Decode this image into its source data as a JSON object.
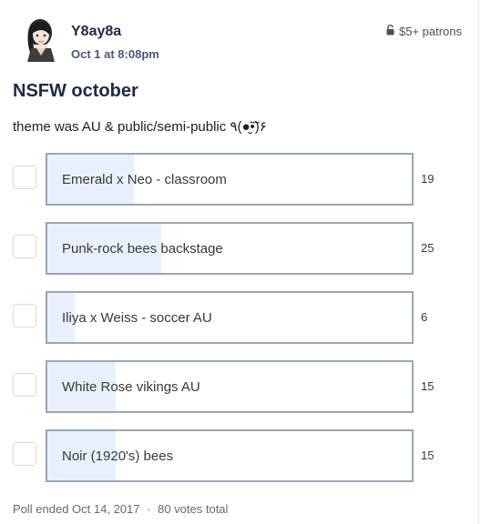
{
  "post": {
    "author": "Y8ay8a",
    "date": "Oct 1 at 8:08pm",
    "tier_label": "$5+ patrons",
    "tier_icon": "lock-icon",
    "title": "NSFW october",
    "description": "theme was AU & public/semi-public ٩(●̮̮̃•̃)۶"
  },
  "poll": {
    "total_votes": 80,
    "options": [
      {
        "label": "Emerald x Neo - classroom",
        "votes": "19",
        "fraction": 0.2375
      },
      {
        "label": "Punk-rock bees backstage",
        "votes": "25",
        "fraction": 0.3125
      },
      {
        "label": "Iliya x Weiss - soccer AU",
        "votes": "6",
        "fraction": 0.075
      },
      {
        "label": "White Rose vikings AU",
        "votes": "15",
        "fraction": 0.1875
      },
      {
        "label": "Noir (1920's) bees",
        "votes": "15",
        "fraction": 0.1875
      }
    ],
    "footer_ended": "Poll ended Oct 14, 2017",
    "footer_separator": "·",
    "footer_total": "80 votes total"
  },
  "colors": {
    "fill": "#e8f0fb",
    "border": "#9aa6b4",
    "title": "#1f2a44"
  }
}
